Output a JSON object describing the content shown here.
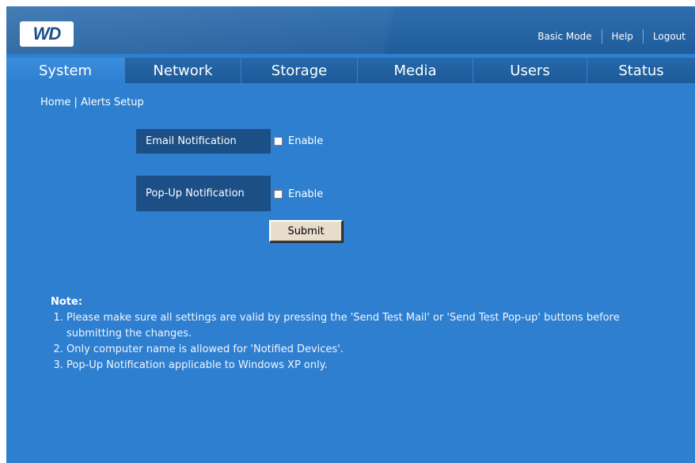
{
  "header": {
    "logo_text": "WD",
    "links": [
      "Basic Mode",
      "Help",
      "Logout"
    ]
  },
  "tabs": [
    "System",
    "Network",
    "Storage",
    "Media",
    "Users",
    "Status"
  ],
  "active_tab": "System",
  "breadcrumb": {
    "home": "Home",
    "separator": "|",
    "current": "Alerts Setup"
  },
  "form": {
    "email_label": "Email Notification",
    "email_checkbox_label": "Enable",
    "email_checked": false,
    "popup_label": "Pop-Up Notification",
    "popup_checkbox_label": "Enable",
    "popup_checked": false,
    "submit_label": "Submit"
  },
  "notes": {
    "title": "Note:",
    "items": [
      "Please make sure all settings are valid by pressing the 'Send Test Mail' or 'Send Test Pop-up' buttons before submitting the changes.",
      "Only computer name is allowed for 'Notified Devices'.",
      "Pop-Up Notification applicable to Windows XP only."
    ]
  },
  "colors": {
    "background": "#2e7fd0",
    "header": "#1f5c9b",
    "label_box": "#1b4f86",
    "button": "#e8dccb"
  }
}
